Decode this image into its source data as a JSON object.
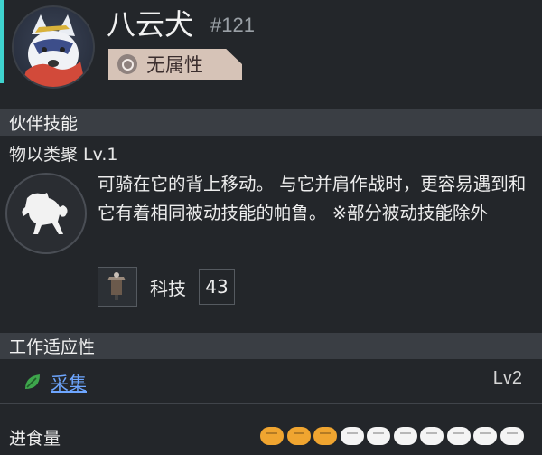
{
  "pal": {
    "name": "八云犬",
    "number": "#121",
    "element": "无属性",
    "element_icon": "neutral-element-icon"
  },
  "partner_skill": {
    "section_title": "伙伴技能",
    "name": "物以类聚 Lv.1",
    "icon": "horse-icon",
    "description": "可骑在它的背上移动。 与它并肩作战时，更容易遇到和它有着相同被动技能的帕鲁。 ※部分被动技能除外",
    "tech_item_icon": "tech-item-icon",
    "tech_label": "科技",
    "tech_value": "43"
  },
  "work_suitability": {
    "section_title": "工作适应性",
    "items": [
      {
        "icon": "leaf-icon",
        "label": "采集",
        "level": "Lv2"
      }
    ]
  },
  "food": {
    "label": "进食量",
    "filled": 3,
    "total": 10
  },
  "colors": {
    "accent": "#3fd3cf",
    "element_tag_bg": "#d6c3b7",
    "link": "#6ea6ff",
    "food_filled": "#f0a530",
    "food_empty": "#f4f4f4"
  }
}
